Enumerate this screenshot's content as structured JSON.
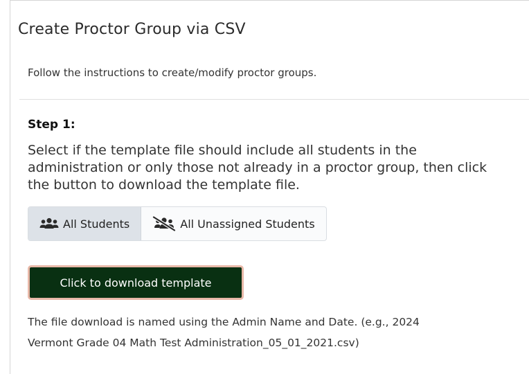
{
  "panel": {
    "title": "Create Proctor Group via CSV",
    "instructions": "Follow the instructions to create/modify proctor groups."
  },
  "step1": {
    "heading": "Step 1:",
    "description": "Select if the template file should include all students in the administration or only those not already in a proctor group, then click the button to download the template file.",
    "toggle_all": "All Students",
    "toggle_all_icon": "users-icon",
    "toggle_unassigned": "All Unassigned Students",
    "toggle_unassigned_icon": "users-slash-icon",
    "selected": "All Students",
    "download_label": "Click to download template",
    "note_line1": "The file download is named using the Admin Name and Date. (e.g., 2024",
    "note_line2": "Vermont Grade 04 Math Test Administration_05_01_2021.csv)"
  },
  "colors": {
    "download_bg": "#093012",
    "download_border": "#e8b8a8",
    "toggle_active_bg": "#dde2e8"
  }
}
